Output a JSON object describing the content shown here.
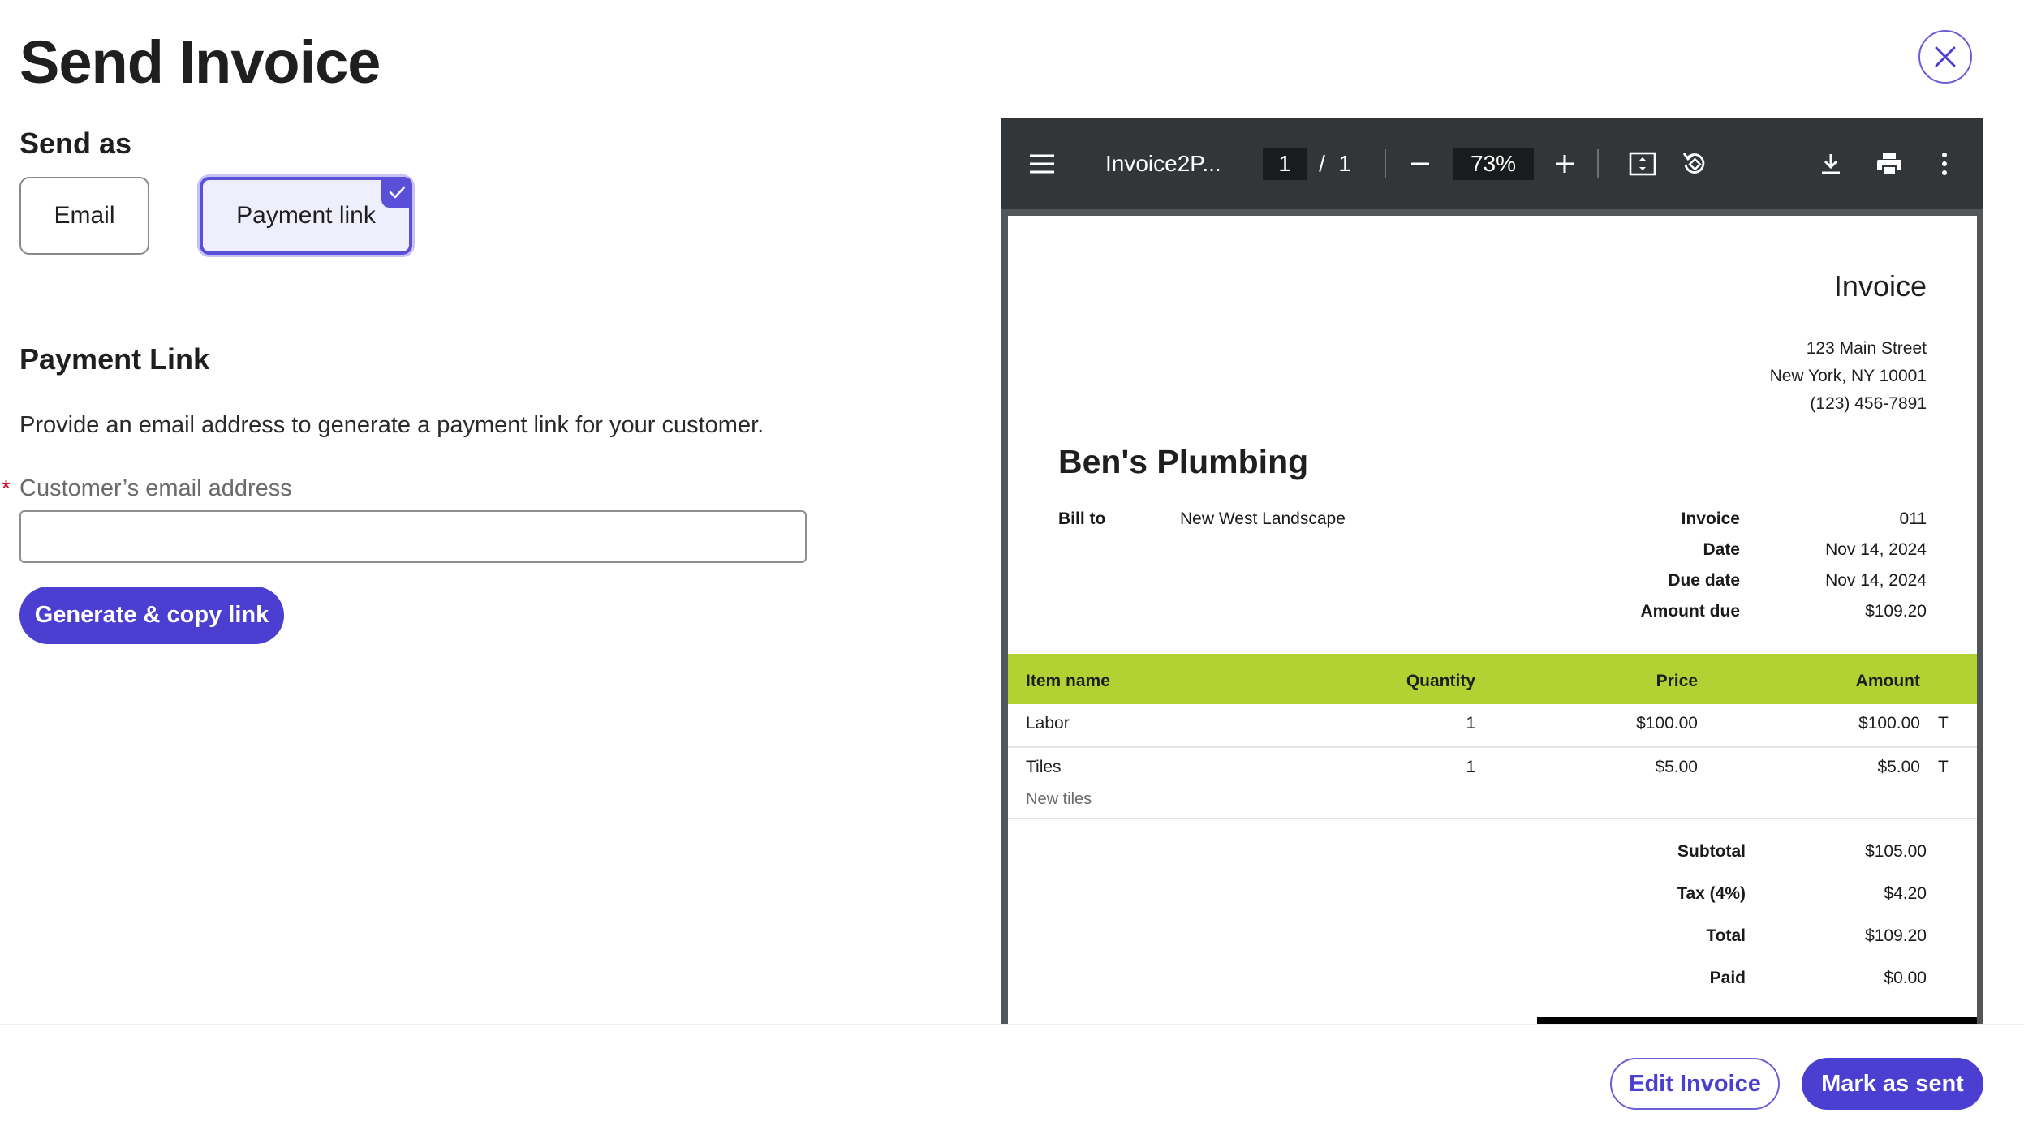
{
  "header": {
    "title": "Send Invoice",
    "close_icon": "close-icon"
  },
  "send_as": {
    "label": "Send as",
    "options": [
      {
        "label": "Email",
        "selected": false
      },
      {
        "label": "Payment link",
        "selected": true
      }
    ]
  },
  "payment_link": {
    "title": "Payment Link",
    "description": "Provide an email address to generate a payment link for your customer.",
    "required_mark": "*",
    "email_label": "Customer’s email address",
    "email_value": "",
    "email_placeholder": "",
    "generate_label": "Generate & copy link"
  },
  "viewer": {
    "file_name": "Invoice2P...",
    "page_current": "1",
    "page_separator": "/",
    "page_total": "1",
    "zoom": "73%"
  },
  "invoice": {
    "title": "Invoice",
    "address_lines": [
      "123 Main Street",
      "New York, NY 10001",
      "(123) 456-7891"
    ],
    "company": "Ben's Plumbing",
    "bill_to_label": "Bill to",
    "bill_to_value": "New West Landscape",
    "meta": [
      {
        "label": "Invoice",
        "value": "011"
      },
      {
        "label": "Date",
        "value": "Nov 14, 2024"
      },
      {
        "label": "Due date",
        "value": "Nov 14, 2024"
      },
      {
        "label": "Amount due",
        "value": "$109.20"
      }
    ],
    "columns": {
      "item": "Item name",
      "quantity": "Quantity",
      "price": "Price",
      "amount": "Amount"
    },
    "items": [
      {
        "name": "Labor",
        "quantity": "1",
        "price": "$100.00",
        "amount": "$100.00",
        "tax_flag": "T",
        "note": ""
      },
      {
        "name": "Tiles",
        "quantity": "1",
        "price": "$5.00",
        "amount": "$5.00",
        "tax_flag": "T",
        "note": "New tiles"
      }
    ],
    "totals": [
      {
        "label": "Subtotal",
        "value": "$105.00"
      },
      {
        "label": "Tax (4%)",
        "value": "$4.20"
      },
      {
        "label": "Total",
        "value": "$109.20"
      },
      {
        "label": "Paid",
        "value": "$0.00"
      }
    ],
    "header_color": "#b2d234"
  },
  "footer": {
    "edit_label": "Edit Invoice",
    "mark_sent_label": "Mark as sent"
  },
  "colors": {
    "accent": "#4a3fd1",
    "accent_light": "#efeefd",
    "required": "#c8102e"
  }
}
